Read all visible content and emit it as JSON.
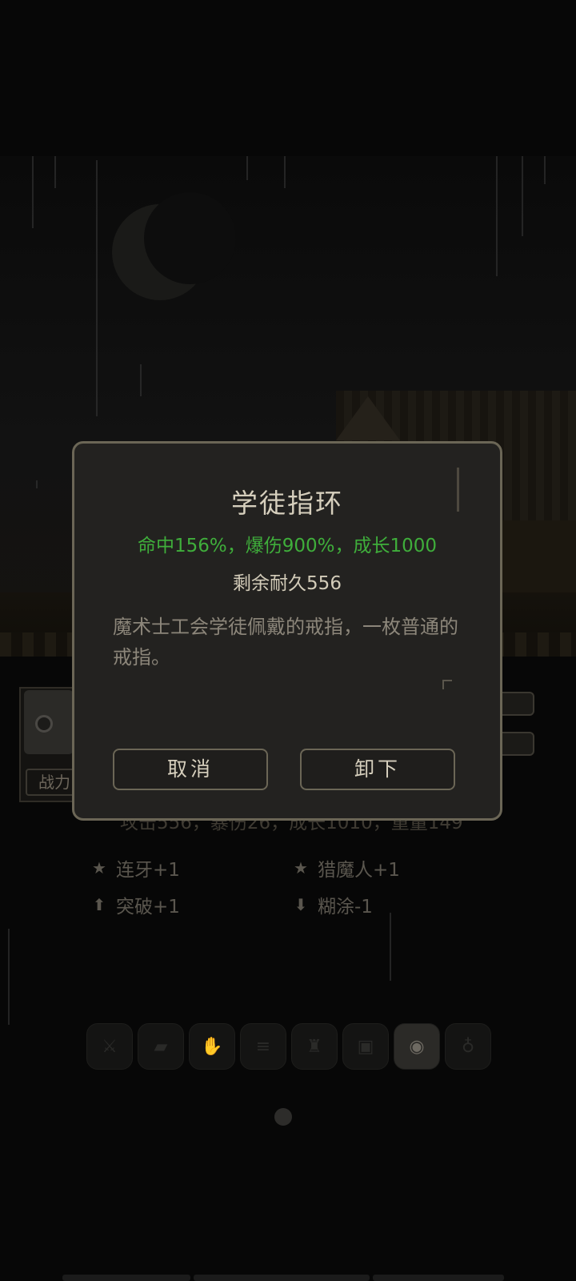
{
  "dialog": {
    "title": "学徒指环",
    "stats": "命中156%，爆伤900%，成长1000",
    "durability": "剩余耐久556",
    "description": "魔术士工会学徒佩戴的戒指，一枚普通的戒指。",
    "cancel_label": "取消",
    "unequip_label": "卸下"
  },
  "character": {
    "power_label": "战力"
  },
  "background_stats": "攻击556，暴伤26，成长1010，重量149",
  "traits": [
    {
      "icon": "star-icon",
      "label": "连牙+1"
    },
    {
      "icon": "star-icon",
      "label": "猎魔人+1"
    },
    {
      "icon": "arrow-up-icon",
      "label": "突破+1"
    },
    {
      "icon": "arrow-down-icon",
      "label": "糊涂-1"
    }
  ],
  "equipment_slots": [
    "sword-icon",
    "boots-icon",
    "glove-icon",
    "belt-icon",
    "armor-icon",
    "bag-icon",
    "ring-icon",
    "amulet-icon"
  ],
  "active_slot_index": 6,
  "colors": {
    "stat_green": "#3fae3b",
    "dialog_bg": "#232220",
    "dialog_border": "#6b6656",
    "title_text": "#d6cfbd"
  }
}
